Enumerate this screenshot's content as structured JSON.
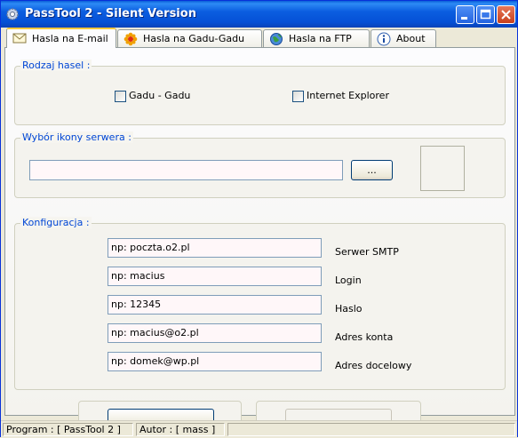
{
  "window": {
    "title": "PassTool 2 - Silent  Version"
  },
  "tabs": [
    {
      "label": "Hasla na E-mail",
      "icon": "envelope-icon",
      "active": true
    },
    {
      "label": "Hasla na Gadu-Gadu",
      "icon": "gadu-flower-icon",
      "active": false
    },
    {
      "label": "Hasla na FTP",
      "icon": "globe-icon",
      "active": false
    },
    {
      "label": "About",
      "icon": "info-icon",
      "active": false
    }
  ],
  "password_type": {
    "title": "Rodzaj hasel :",
    "options": [
      {
        "label": "Gadu - Gadu",
        "checked": false
      },
      {
        "label": "Internet Explorer",
        "checked": false
      }
    ]
  },
  "server_icon": {
    "title": "Wybór ikony serwera :",
    "path_value": "",
    "browse_label": "..."
  },
  "config": {
    "title": "Konfiguracja :",
    "fields": [
      {
        "value": "np: poczta.o2.pl",
        "label": "Serwer SMTP"
      },
      {
        "value": "np: macius",
        "label": "Login"
      },
      {
        "value": "np: 12345",
        "label": "Haslo"
      },
      {
        "value": "np: macius@o2.pl",
        "label": "Adres konta"
      },
      {
        "value": "np: domek@wp.pl",
        "label": "Adres docelowy"
      }
    ]
  },
  "statusbar": {
    "program": "Program : [ PassTool 2 ]",
    "author": "Autor : [ mass ]"
  },
  "colors": {
    "titlebar": "#0550d6",
    "group_title": "#0046d5",
    "active_tab_accent": "#ffc83c"
  }
}
